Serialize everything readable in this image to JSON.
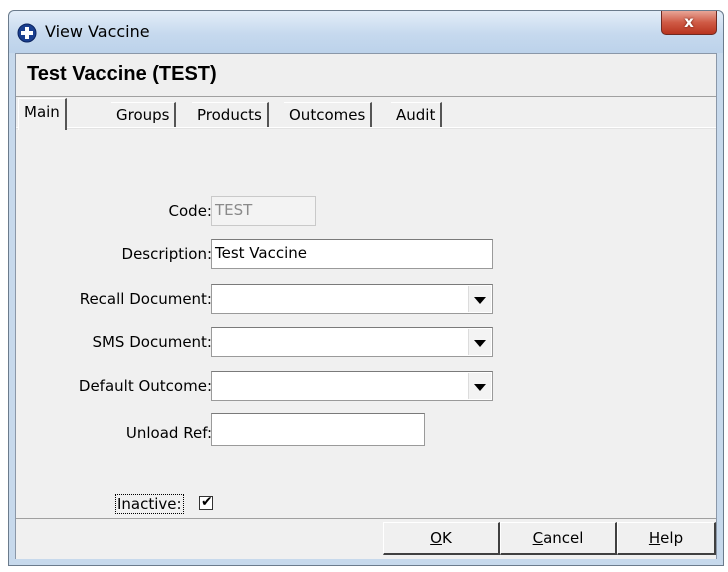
{
  "window": {
    "title": "View Vaccine",
    "close_glyph": "x"
  },
  "header": {
    "title": "Test Vaccine (TEST)"
  },
  "tabs": [
    {
      "label": "Main"
    },
    {
      "label": "Groups"
    },
    {
      "label": "Products"
    },
    {
      "label": "Outcomes"
    },
    {
      "label": "Audit"
    }
  ],
  "form": {
    "code": {
      "label": "Code:",
      "value": "TEST"
    },
    "description": {
      "label": "Description:",
      "value": "Test Vaccine"
    },
    "recall_document": {
      "label": "Recall Document:",
      "value": ""
    },
    "sms_document": {
      "label": "SMS Document:",
      "value": ""
    },
    "default_outcome": {
      "label": "Default Outcome:",
      "value": ""
    },
    "unload_ref": {
      "label": "Unload Ref:",
      "value": ""
    },
    "inactive": {
      "label": "Inactive:",
      "checked": true,
      "check_glyph": "✔"
    }
  },
  "buttons": {
    "ok": {
      "accel": "O",
      "rest": "K"
    },
    "cancel": {
      "accel": "C",
      "rest": "ancel"
    },
    "help": {
      "accel": "H",
      "rest": "elp"
    }
  },
  "icons": {
    "app": "app-cross-icon",
    "close": "close-icon",
    "dropdown": "chevron-down-icon",
    "checkbox": "checkmark-icon"
  },
  "colors": {
    "title_bar": "#c6d9ee",
    "close_button": "#cf5a45",
    "face": "#f0f0f0"
  }
}
